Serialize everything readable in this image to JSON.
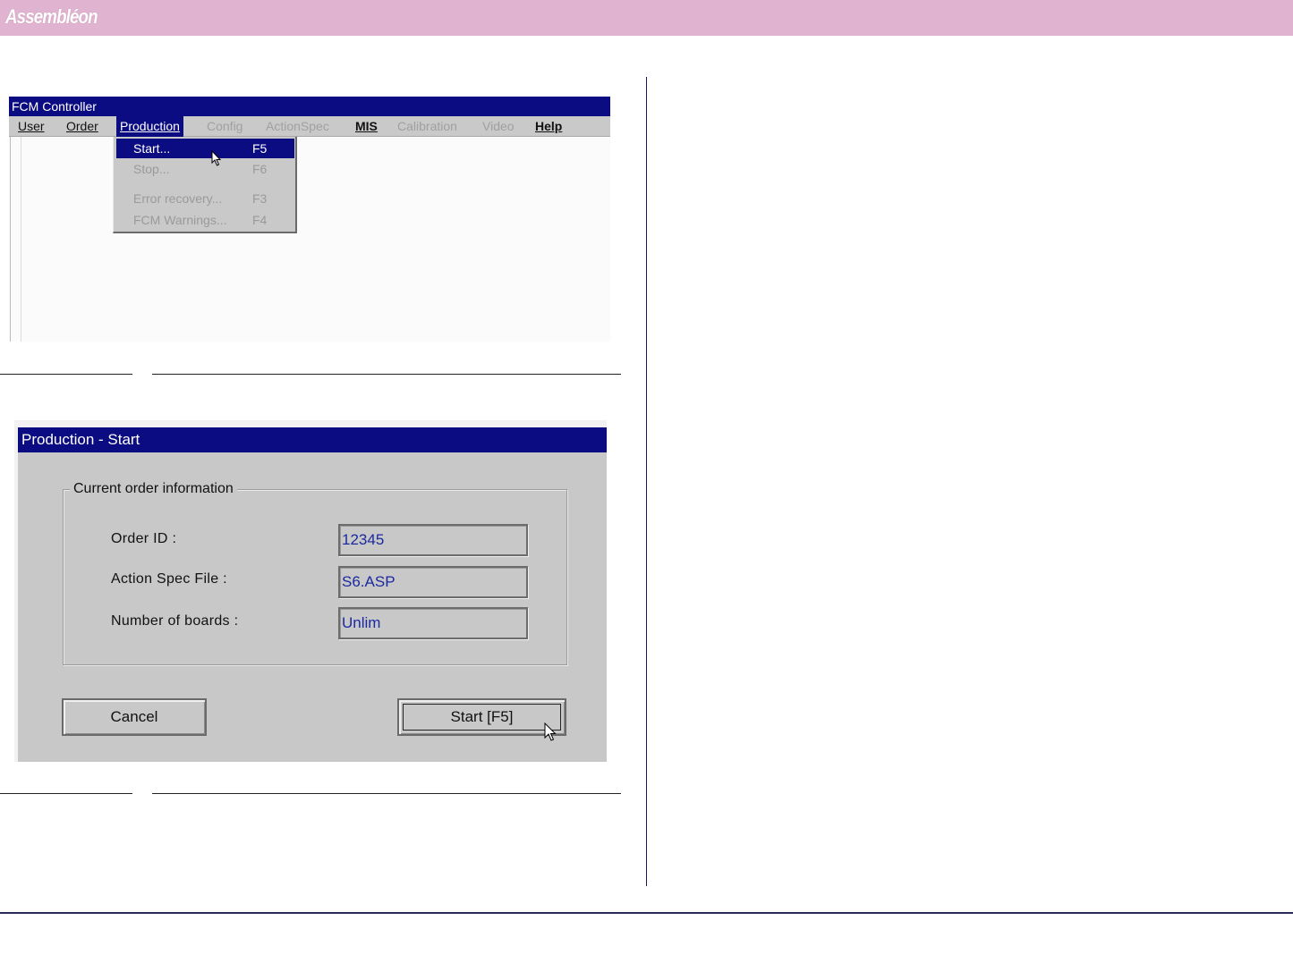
{
  "brand": {
    "logo_text": "Assembléon"
  },
  "controller": {
    "title": "FCM Controller",
    "menu": [
      {
        "label": "User",
        "state": "normal"
      },
      {
        "label": "Order",
        "state": "normal"
      },
      {
        "label": "Production",
        "state": "active"
      },
      {
        "label": "Config",
        "state": "disabled"
      },
      {
        "label": "ActionSpec",
        "state": "disabled"
      },
      {
        "label": "MIS",
        "state": "normal"
      },
      {
        "label": "Calibration",
        "state": "disabled"
      },
      {
        "label": "Video",
        "state": "disabled"
      },
      {
        "label": "Help",
        "state": "normal"
      }
    ],
    "production_menu": [
      {
        "label": "Start...",
        "shortcut": "F5",
        "state": "highlighted"
      },
      {
        "label": "Stop...",
        "shortcut": "F6",
        "state": "disabled"
      },
      {
        "label": "Error recovery...",
        "shortcut": "F3",
        "state": "disabled"
      },
      {
        "label": "FCM Warnings...",
        "shortcut": "F4",
        "state": "disabled"
      }
    ]
  },
  "dialog": {
    "title": "Production - Start",
    "group_label": "Current order information",
    "fields": [
      {
        "label": "Order ID :",
        "value": "12345"
      },
      {
        "label": "Action Spec File :",
        "value": "S6.ASP"
      },
      {
        "label": "Number of boards :",
        "value": "Unlim"
      }
    ],
    "cancel_label": "Cancel",
    "start_label": "Start [F5]"
  },
  "colors": {
    "brand_bar": "#e0b4d0",
    "title_bar": "#0c0c82",
    "field_text": "#1a2aa0",
    "dialog_bg": "#c8c8c8"
  }
}
